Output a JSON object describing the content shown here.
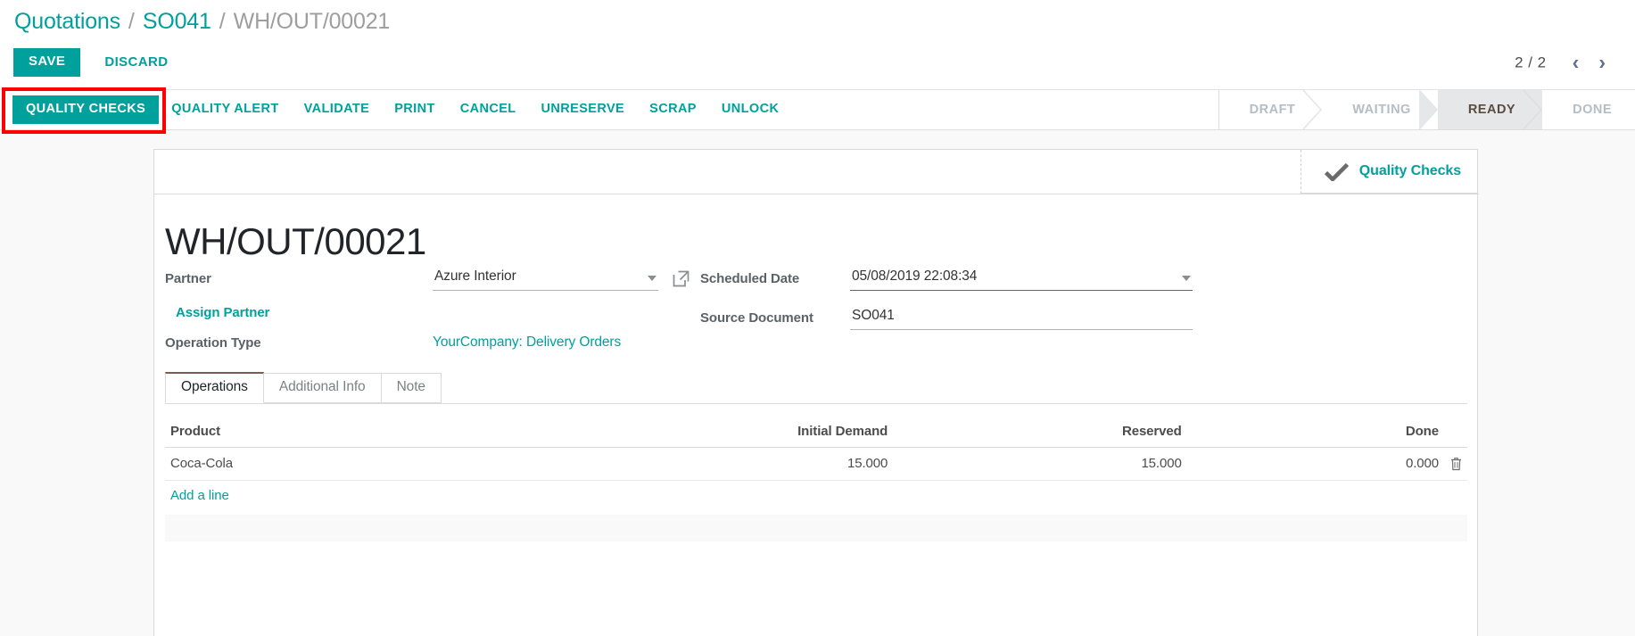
{
  "breadcrumb": {
    "items": [
      {
        "label": "Quotations",
        "current": false
      },
      {
        "label": "SO041",
        "current": false
      },
      {
        "label": "WH/OUT/00021",
        "current": true
      }
    ],
    "separator": "/"
  },
  "controls": {
    "save_label": "SAVE",
    "discard_label": "DISCARD"
  },
  "pager": {
    "count": "2 / 2",
    "prev": "‹",
    "next": "›"
  },
  "action_bar": {
    "primary": {
      "label": "QUALITY CHECKS",
      "highlighted": true
    },
    "buttons": [
      {
        "label": "QUALITY ALERT"
      },
      {
        "label": "VALIDATE"
      },
      {
        "label": "PRINT"
      },
      {
        "label": "CANCEL"
      },
      {
        "label": "UNRESERVE"
      },
      {
        "label": "SCRAP"
      },
      {
        "label": "UNLOCK"
      }
    ]
  },
  "statusbar": {
    "steps": [
      {
        "label": "DRAFT",
        "active": false
      },
      {
        "label": "WAITING",
        "active": false
      },
      {
        "label": "READY",
        "active": true
      },
      {
        "label": "DONE",
        "active": false
      }
    ]
  },
  "button_box": {
    "stat_buttons": [
      {
        "icon": "check-icon",
        "label": "Quality Checks"
      }
    ]
  },
  "form": {
    "title": "WH/OUT/00021",
    "left": {
      "partner_label": "Partner",
      "partner_value": "Azure Interior",
      "assign_partner_label": "Assign Partner",
      "operation_type_label": "Operation Type",
      "operation_type_value": "YourCompany: Delivery Orders"
    },
    "right": {
      "scheduled_date_label": "Scheduled Date",
      "scheduled_date_value": "05/08/2019 22:08:34",
      "source_document_label": "Source Document",
      "source_document_value": "SO041"
    }
  },
  "notebook": {
    "tabs": [
      {
        "label": "Operations",
        "active": true
      },
      {
        "label": "Additional Info",
        "active": false
      },
      {
        "label": "Note",
        "active": false
      }
    ]
  },
  "operations_table": {
    "columns": [
      "Product",
      "Initial Demand",
      "Reserved",
      "Done"
    ],
    "rows": [
      {
        "product": "Coca-Cola",
        "initial_demand": "15.000",
        "reserved": "15.000",
        "done": "0.000",
        "delete_icon": "trash-icon"
      }
    ],
    "add_line_label": "Add a line"
  },
  "colors": {
    "accent": "#00a09d",
    "breadcrumb_current": "#9e9e9e",
    "status_active_bg": "#e5e7e9",
    "status_inactive_text": "#b5bdc4",
    "annotation": "#ff0000"
  }
}
